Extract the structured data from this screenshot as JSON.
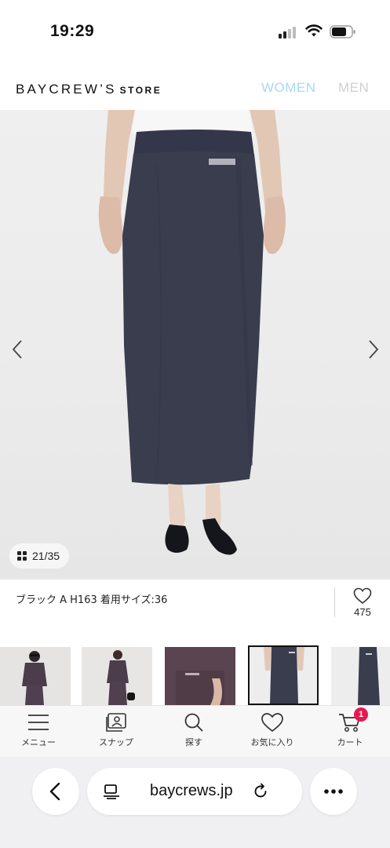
{
  "status_bar": {
    "time": "19:29",
    "icons": [
      "signal-icon",
      "wifi-icon",
      "battery-icon"
    ]
  },
  "header": {
    "logo_main": "BAYCREW’S",
    "logo_sub": "STORE",
    "nav": [
      {
        "label": "WOMEN",
        "color": "#a9d8f0",
        "selected": true
      },
      {
        "label": "MEN",
        "color": "#cfcfcf",
        "selected": false
      }
    ]
  },
  "gallery": {
    "counter": "21/35",
    "prev_icon": "chevron-left-icon",
    "next_icon": "chevron-right-icon",
    "grid_icon": "grid-icon",
    "skirt_color": "#3a3d4e",
    "background": "#ececec"
  },
  "caption": {
    "text": "ブラック A H163 着用サイズ:36",
    "favorite_count": "475",
    "favorite_icon": "heart-outline-icon"
  },
  "thumbnails": {
    "count_visible": 5,
    "active_index": 3
  },
  "tabbar": {
    "tabs": [
      {
        "label": "メニュー",
        "icon": "hamburger-menu-icon"
      },
      {
        "label": "スナップ",
        "icon": "snap-photo-icon"
      },
      {
        "label": "探す",
        "icon": "search-icon"
      },
      {
        "label": "お気に入り",
        "icon": "heart-outline-icon"
      },
      {
        "label": "カート",
        "icon": "cart-icon",
        "badge": "1"
      }
    ],
    "badge_color": "#e8184f"
  },
  "browser": {
    "url": "baycrews.jp",
    "icons": [
      "back-chevron-icon",
      "page-icon",
      "reload-icon",
      "more-dots-icon"
    ]
  }
}
